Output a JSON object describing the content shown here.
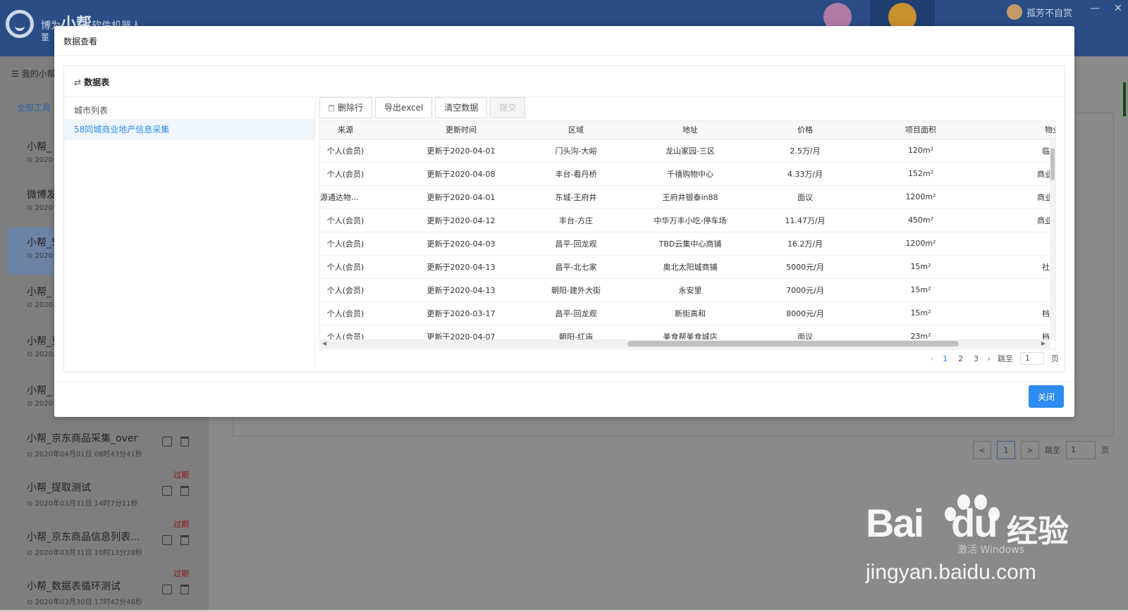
{
  "app": {
    "brand_prefix": "博为",
    "brand_big": "小帮",
    "brand_suffix": "软件机器人",
    "brand_sub": "董",
    "user_name": "孤芳不自赏",
    "minimize": "—",
    "close": "✕"
  },
  "sidebar": {
    "title": "我的小帮",
    "tab": "全部工具",
    "items": [
      {
        "name": "小帮_",
        "time": "2020",
        "expired": ""
      },
      {
        "name": "微博发",
        "time": "2020",
        "expired": ""
      },
      {
        "name": "小帮_5",
        "time": "2020",
        "expired": ""
      },
      {
        "name": "小帮_",
        "time": "2020",
        "expired": ""
      },
      {
        "name": "小帮_豆",
        "time": "2020",
        "expired": ""
      },
      {
        "name": "小帮_",
        "time": "2020",
        "expired": ""
      },
      {
        "name": "小帮_京东商品采集_over",
        "time": "2020年04月01日 08时43分41秒",
        "expired": ""
      },
      {
        "name": "小帮_提取测试",
        "time": "2020年03月31日 14时7分11秒",
        "expired": "过期"
      },
      {
        "name": "小帮_京东商品信息列表...",
        "time": "2020年03月31日 10时13分28秒",
        "expired": "过期"
      },
      {
        "name": "小帮_数据表循环测试",
        "time": "2020年03月30日 17时42分46秒",
        "expired": "过期"
      }
    ]
  },
  "bg_pager": {
    "prev": "<",
    "current": "1",
    "next": ">",
    "jump_label": "跳至",
    "jump_value": "1",
    "page_unit": "页"
  },
  "modal": {
    "title": "数据查看",
    "card_icon": "⇄",
    "card_title": "数据表",
    "city_list_header": "城市列表",
    "city_selected": "58同城商业地产信息采集",
    "toolbar": {
      "delete_row": "删除行",
      "export_excel": "导出excel",
      "clear_data": "清空数据",
      "submit": "提交"
    },
    "table": {
      "columns": [
        "来源",
        "更新时间",
        "区域",
        "地址",
        "价格",
        "项目面积",
        "物业类型"
      ],
      "rows": [
        [
          "个人(会员)",
          "更新于2020-04-01",
          "门头沟-大峪",
          "龙山家园-三区",
          "2.5万/月",
          "120m²",
          "临街门面-"
        ],
        [
          "个人(会员)",
          "更新于2020-04-08",
          "丰台-看丹桥",
          "千禧购物中心",
          "4.33万/月",
          "152m²",
          "商业街店铺"
        ],
        [
          "源通达物业管理有限...",
          "更新于2020-04-01",
          "东城-王府井",
          "王府井银泰in88",
          "面议",
          "1200m²",
          "商业街店铺"
        ],
        [
          "个人(会员)",
          "更新于2020-04-12",
          "丰台-方庄",
          "中华万丰小吃-停车场",
          "11.47万/月",
          "450m²",
          "商业街店铺"
        ],
        [
          "个人(会员)",
          "更新于2020-04-03",
          "昌平-回龙观",
          "TBD云集中心商铺",
          "16.2万/月",
          "1200m²",
          "其他"
        ],
        [
          "个人(会员)",
          "更新于2020-04-13",
          "昌平-北七家",
          "奥北太阳城商铺",
          "5000元/月",
          "15m²",
          "社区底商-"
        ],
        [
          "个人(会员)",
          "更新于2020-04-13",
          "朝阳-建外大街",
          "永安里",
          "7000元/月",
          "15m²",
          "其他-临"
        ],
        [
          "个人(会员)",
          "更新于2020-03-17",
          "昌平-回龙观",
          "新街高和",
          "8000元/月",
          "15m²",
          "档口摊位-"
        ],
        [
          "个人(会员)",
          "更新于2020-04-07",
          "朝阳-红庙",
          "美食帮美食城店",
          "面议",
          "23m²",
          "档口摊位-"
        ]
      ]
    },
    "pager": {
      "prev": "‹",
      "pages": [
        "1",
        "2",
        "3"
      ],
      "current": "1",
      "next": "›",
      "jump_label": "跳至",
      "jump_value": "1",
      "page_unit": "页"
    },
    "close_button": "关闭"
  },
  "watermark": {
    "brand": "Bai",
    "du": "du",
    "product": "经验",
    "url": "jingyan.baidu.com",
    "overlay": "激活 Windows"
  },
  "colors": {
    "header": "#2a4d86",
    "primary": "#2d8cf0",
    "expired": "#8c1414"
  }
}
